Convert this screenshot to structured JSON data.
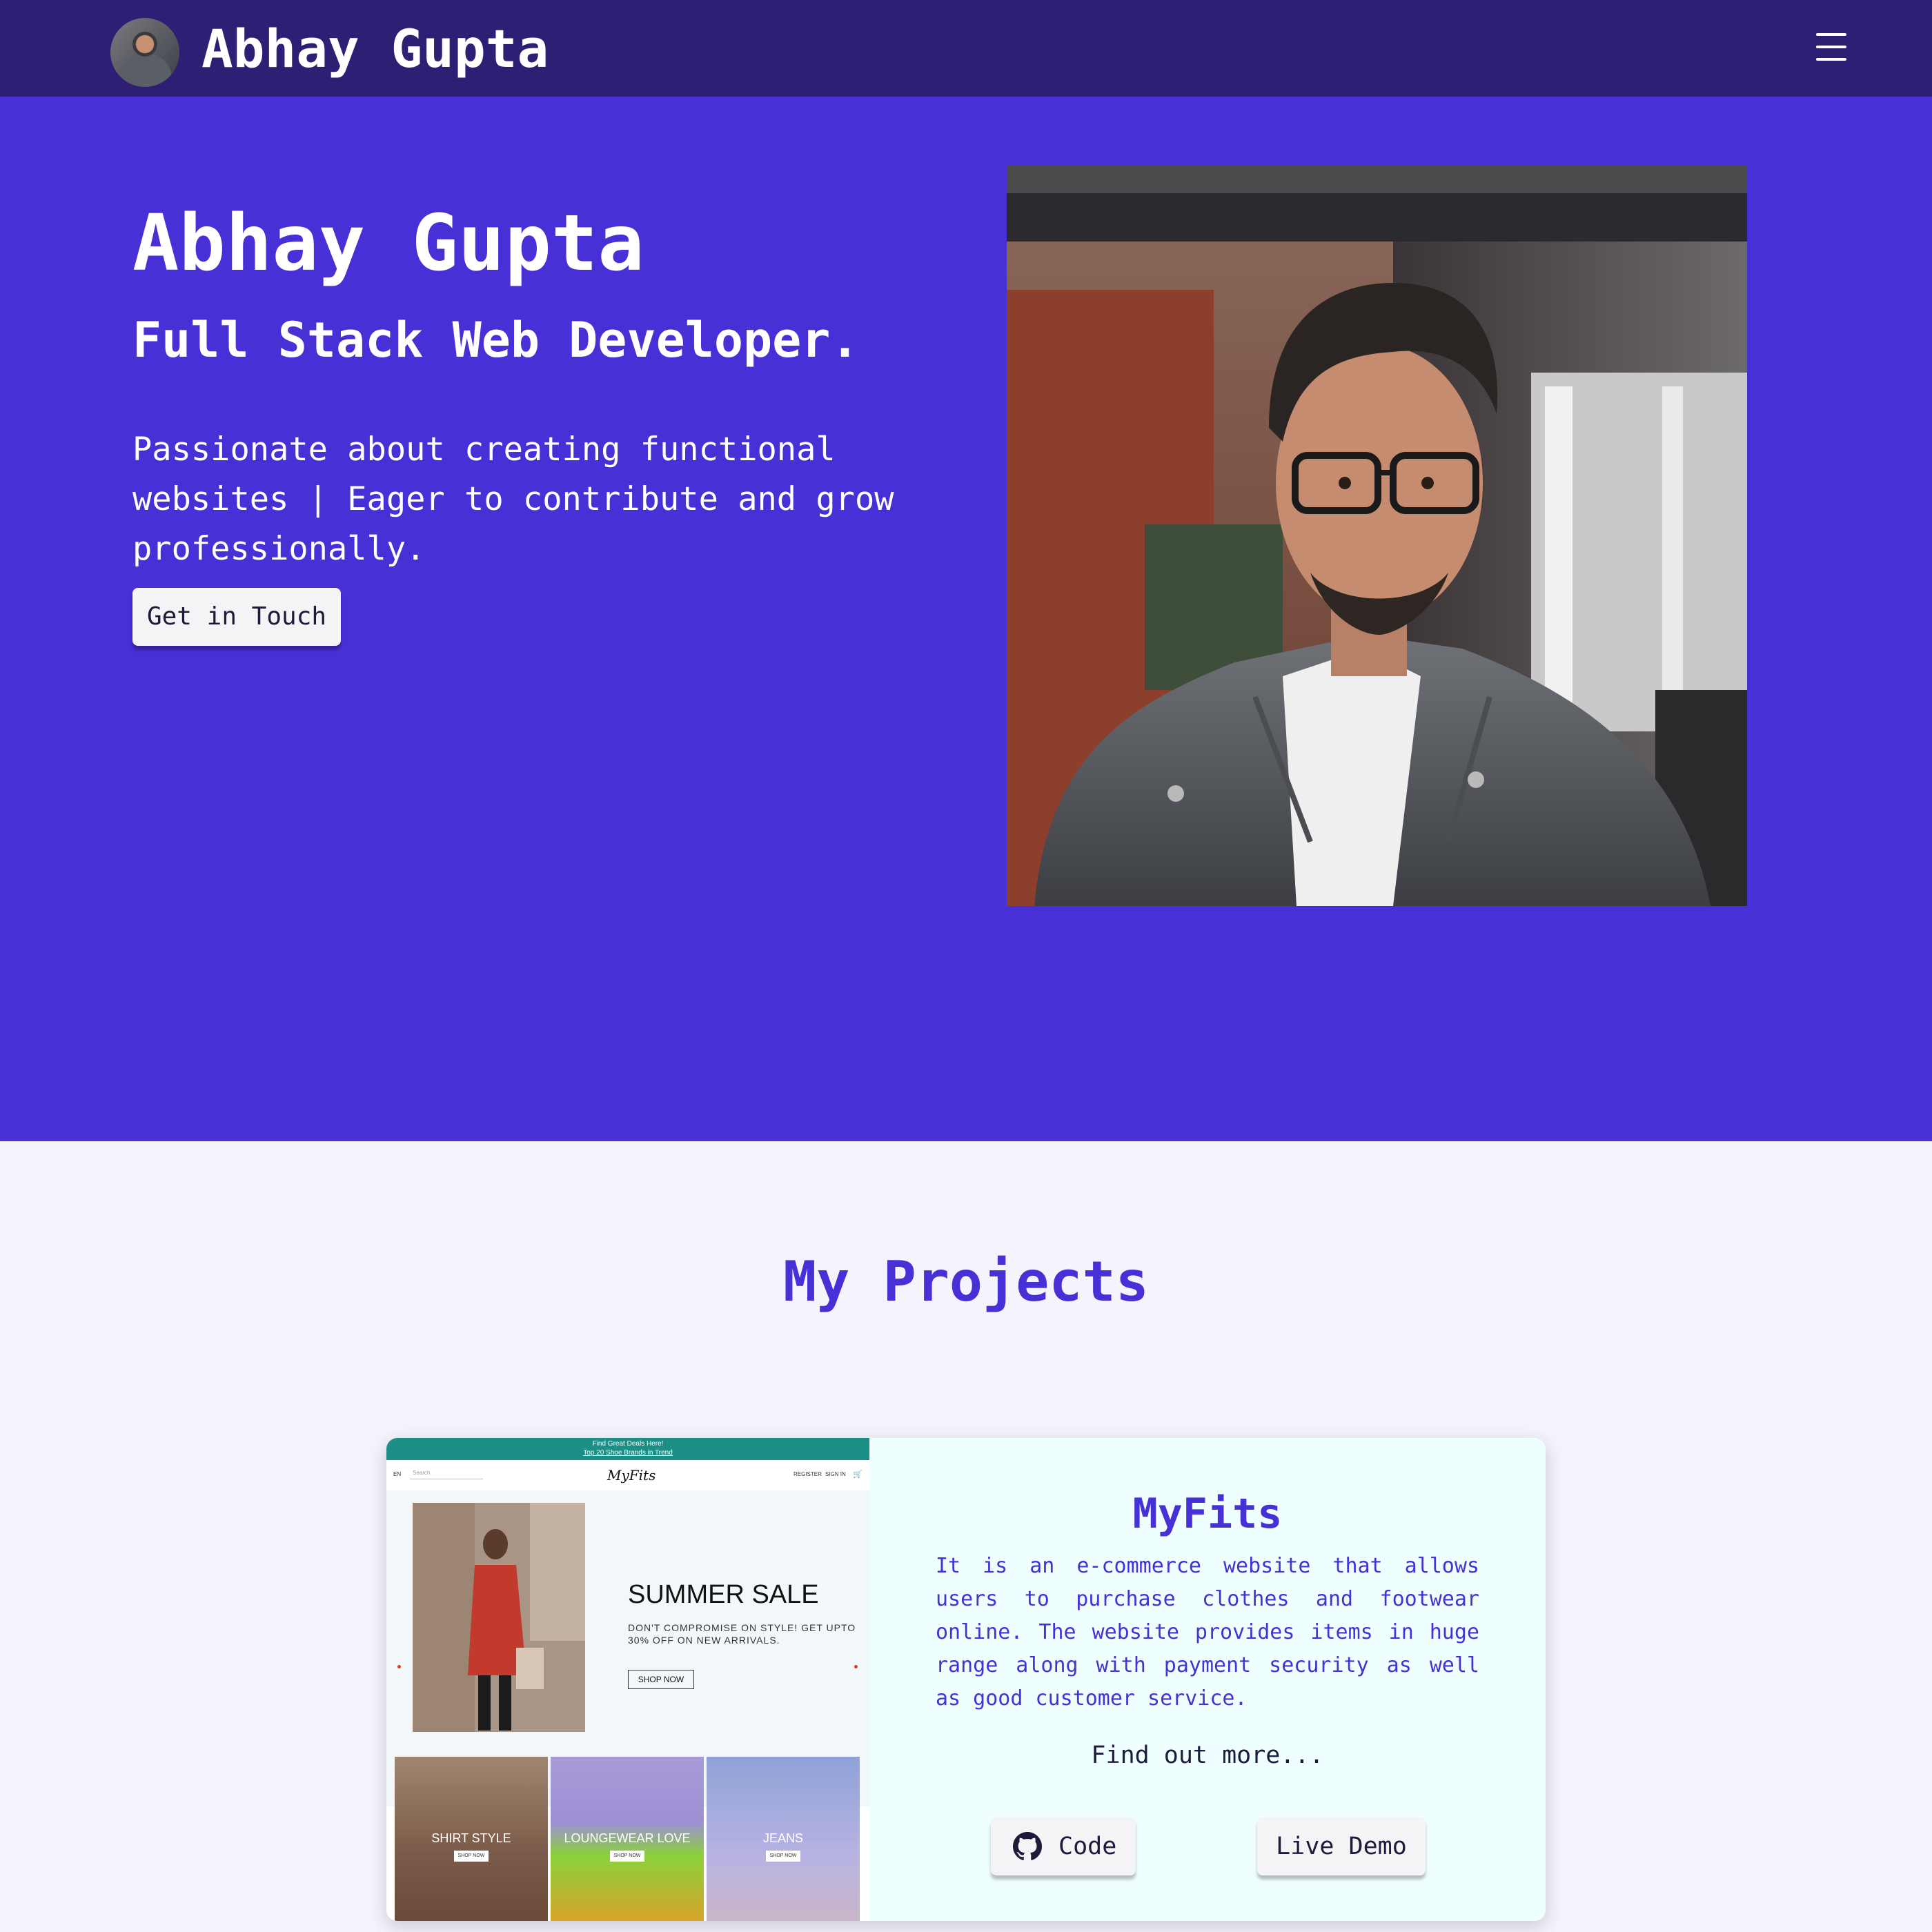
{
  "navbar": {
    "brand": "Abhay Gupta",
    "menu_icon": "hamburger-icon"
  },
  "hero": {
    "name": "Abhay Gupta",
    "role": "Full Stack Web Developer.",
    "description": "Passionate about creating functional websites | Eager to contribute and grow professionally.",
    "cta_label": "Get in Touch"
  },
  "projects": {
    "title": "My Projects",
    "items": [
      {
        "title": "MyFits",
        "description": "It is an e-commerce website that allows users to purchase clothes and footwear online. The website provides items in huge range along with payment security as well as good customer service.",
        "more": "Find out more...",
        "code_label": "Code",
        "code_icon": "github-icon",
        "demo_label": "Live Demo",
        "screenshot": {
          "banner_line1": "Find Great Deals Here!",
          "banner_line2": "Top 20 Shoe Brands in Trend",
          "lang": "EN",
          "search_placeholder": "Search",
          "logo": "MyFits",
          "register": "REGISTER",
          "sign_in": "SIGN IN",
          "sale_title": "SUMMER SALE",
          "sale_sub": "DON'T COMPROMISE ON STYLE! GET UPTO 30% OFF ON NEW ARRIVALS.",
          "shop_now": "SHOP NOW",
          "categories": [
            {
              "label": "SHIRT STYLE",
              "button": "SHOP NOW"
            },
            {
              "label": "LOUNGEWEAR LOVE",
              "button": "SHOP NOW"
            },
            {
              "label": "JEANS",
              "button": "SHOP NOW"
            }
          ]
        }
      }
    ]
  },
  "colors": {
    "navbar": "#2f1f74",
    "hero": "#4730d6",
    "accent": "#4730d6",
    "page_bg": "#f5f3fc",
    "card_bg": "#efffff"
  }
}
